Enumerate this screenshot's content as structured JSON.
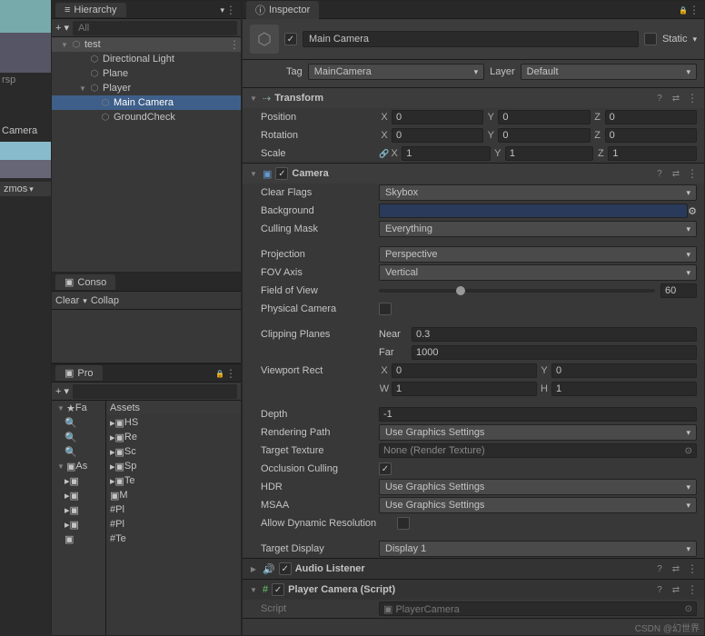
{
  "hierarchy": {
    "tab": "Hierarchy",
    "search_placeholder": "All",
    "scene": "test",
    "items": [
      "Directional Light",
      "Plane",
      "Player",
      "Main Camera",
      "GroundCheck"
    ]
  },
  "console": {
    "tab": "Conso",
    "clear": "Clear",
    "collapse": "Collap"
  },
  "project": {
    "tab": "Pro",
    "assets": "Assets",
    "fav": "Fa",
    "folders": [
      "HS",
      "Re",
      "Sc",
      "Sp",
      "Te",
      "M",
      "Pl",
      "Pl",
      "Te"
    ],
    "as_label": "As"
  },
  "scene": {
    "camera_label": "Camera",
    "gizmos": "zmos",
    "rsp": "rsp"
  },
  "inspector": {
    "tab": "Inspector",
    "static": "Static",
    "name": "Main Camera",
    "tag_label": "Tag",
    "tag": "MainCamera",
    "layer_label": "Layer",
    "layer": "Default",
    "transform": {
      "title": "Transform",
      "position": "Position",
      "rotation": "Rotation",
      "scale": "Scale",
      "px": "0",
      "py": "0",
      "pz": "0",
      "rx": "0",
      "ry": "0",
      "rz": "0",
      "sx": "1",
      "sy": "1",
      "sz": "1"
    },
    "camera": {
      "title": "Camera",
      "clear_flags_label": "Clear Flags",
      "clear_flags": "Skybox",
      "background_label": "Background",
      "culling_label": "Culling Mask",
      "culling": "Everything",
      "projection_label": "Projection",
      "projection": "Perspective",
      "fov_axis_label": "FOV Axis",
      "fov_axis": "Vertical",
      "fov_label": "Field of View",
      "fov": "60",
      "physical_label": "Physical Camera",
      "clipping_label": "Clipping Planes",
      "near_label": "Near",
      "near": "0.3",
      "far_label": "Far",
      "far": "1000",
      "viewport_label": "Viewport Rect",
      "vx": "0",
      "vy": "0",
      "vw": "1",
      "vh": "1",
      "depth_label": "Depth",
      "depth": "-1",
      "rendering_label": "Rendering Path",
      "rendering": "Use Graphics Settings",
      "texture_label": "Target Texture",
      "texture": "None (Render Texture)",
      "occlusion_label": "Occlusion Culling",
      "hdr_label": "HDR",
      "hdr": "Use Graphics Settings",
      "msaa_label": "MSAA",
      "msaa": "Use Graphics Settings",
      "dynamic_label": "Allow Dynamic Resolution",
      "display_label": "Target Display",
      "display": "Display 1"
    },
    "audio": {
      "title": "Audio Listener"
    },
    "player_camera": {
      "title": "Player Camera (Script)",
      "script_label": "Script",
      "script": "PlayerCamera"
    }
  },
  "watermark": "CSDN @幻世界"
}
